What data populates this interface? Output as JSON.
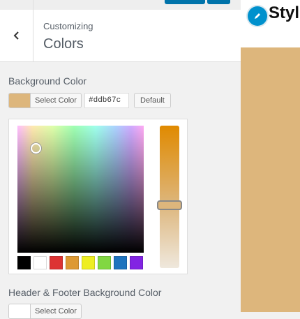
{
  "header": {
    "breadcrumb": "Customizing",
    "title": "Colors"
  },
  "controls": {
    "background": {
      "label": "Background Color",
      "select_label": "Select Color",
      "hex_value": "#ddb67c",
      "default_label": "Default",
      "color": "#ddb67c"
    },
    "header_footer": {
      "label": "Header & Footer Background Color",
      "select_label": "Select Color",
      "color": "#ffffff"
    }
  },
  "palette": [
    "#000000",
    "#ffffff",
    "#dd3333",
    "#dd9933",
    "#eeee22",
    "#81d742",
    "#1e73be",
    "#8224e3"
  ],
  "preview": {
    "site_title": "Styl",
    "background_color": "#ddb67c"
  },
  "colors": {
    "accent": "#0073aa",
    "logo": "#0091cd"
  }
}
